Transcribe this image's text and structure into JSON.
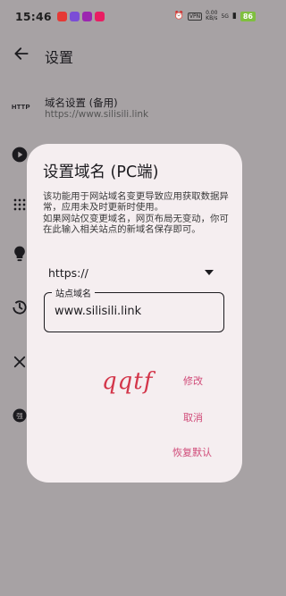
{
  "status_bar": {
    "time": "15:46",
    "notification_colors": [
      "#e53935",
      "#7b4dd6",
      "#9c27b0",
      "#e91e63"
    ],
    "vpn": "VPN",
    "net_speed": "0.00",
    "net_unit": "KB/s",
    "signal": "5G",
    "battery": "86"
  },
  "app_bar": {
    "title": "设置"
  },
  "background_rows": [
    {
      "icon": "HTTP",
      "title": "域名设置 (备用)",
      "subtitle": "https://www.silisili.link"
    }
  ],
  "dialog": {
    "title": "设置域名 (PC端)",
    "description": "该功能用于网站域名变更导致应用获取数据异常，应用未及时更新时使用。\n如果网站仅变更域名，网页布局无变动，你可在此输入相关站点的新域名保存即可。",
    "protocol_select": "https://",
    "domain_field": {
      "label": "站点域名",
      "value": "www.silisili.link"
    },
    "handwritten_text": "qqtf",
    "buttons": {
      "modify": "修改",
      "cancel": "取消",
      "restore": "恢复默认"
    }
  },
  "colors": {
    "scrim": "#a7a2a4",
    "dialog_bg": "#f5eef0",
    "accent": "#d04a78",
    "handwriting": "#d3364a"
  }
}
